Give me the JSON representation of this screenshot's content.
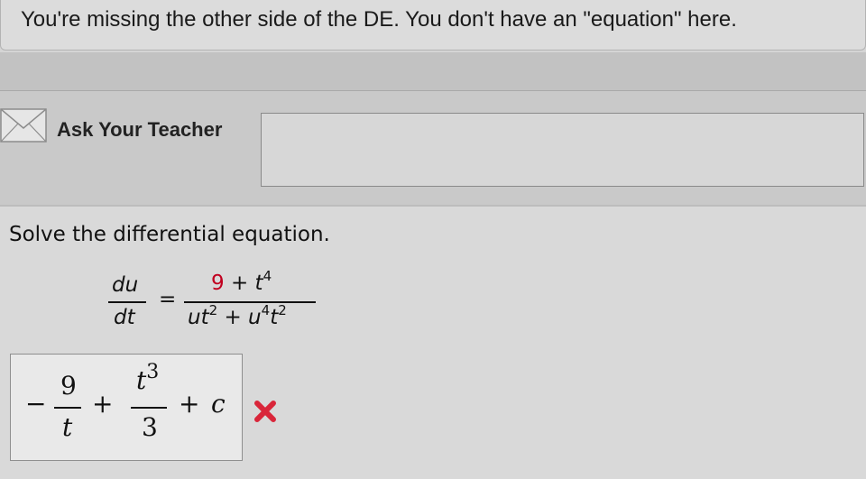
{
  "feedback": {
    "text": "You're missing the other side of the DE.  You don't have an \"equation\" here."
  },
  "ask_teacher": {
    "label": "Ask Your Teacher",
    "icon": "envelope-icon"
  },
  "question": {
    "prompt": "Solve the differential equation.",
    "equation": {
      "lhs_num": "du",
      "lhs_den": "dt",
      "equals": "=",
      "rhs_num_highlight": "9",
      "rhs_num_rest": " + t",
      "rhs_num_exp": "4",
      "rhs_den_u": "ut",
      "rhs_den_exp1": "2",
      "rhs_den_mid": " + u",
      "rhs_den_exp2": "4",
      "rhs_den_t": "t",
      "rhs_den_exp3": "2",
      "highlight_color": "#c1001f"
    },
    "answer": {
      "minus": "−",
      "frac1_num": "9",
      "frac1_den": "t",
      "plus1": "+",
      "frac2_num_base": "t",
      "frac2_num_exp": "3",
      "frac2_den": "3",
      "plus2": "+",
      "const": "c",
      "status_icon": "wrong-x-icon",
      "status_color": "#d9263a"
    }
  }
}
